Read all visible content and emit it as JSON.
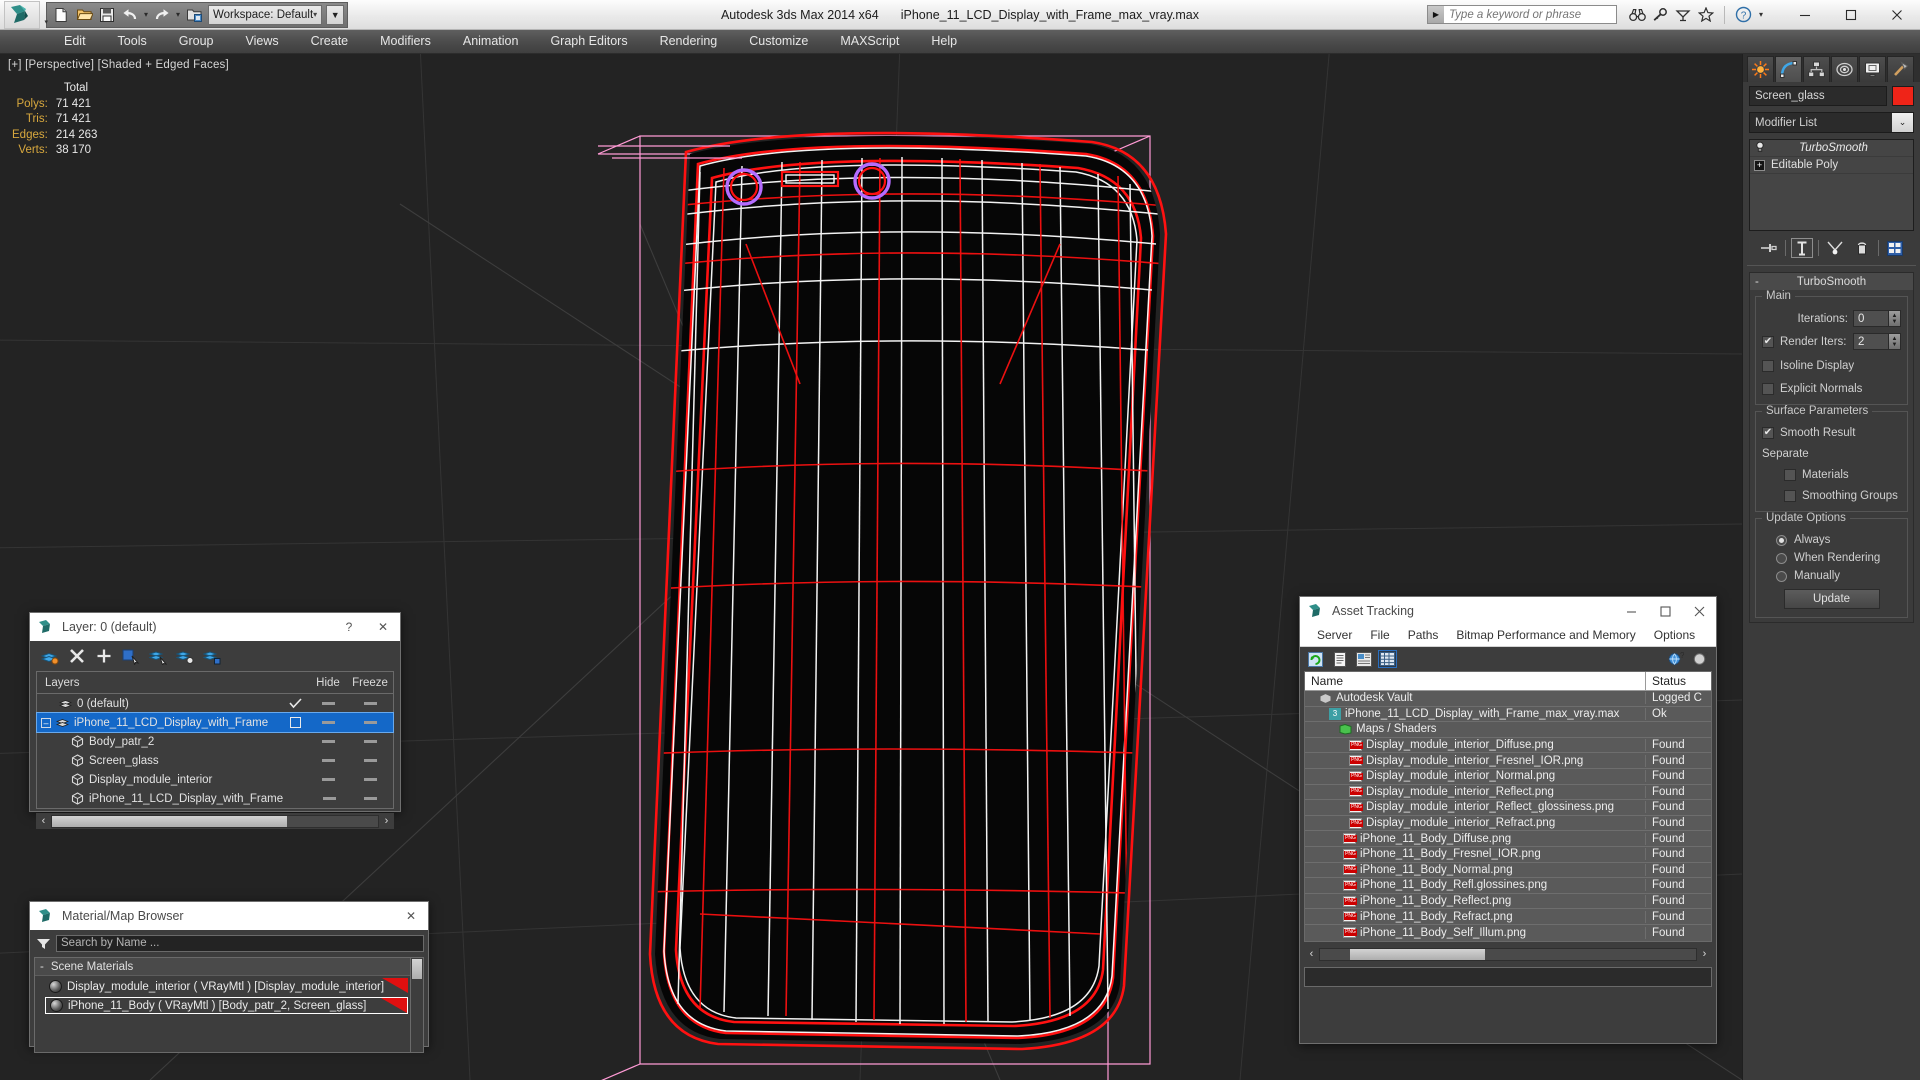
{
  "app": {
    "title": "Autodesk 3ds Max  2014 x64",
    "file_title": "iPhone_11_LCD_Display_with_Frame_max_vray.max",
    "workspace": "Workspace: Default",
    "search_placeholder": "Type a keyword or phrase"
  },
  "window_controls": {
    "minimize": "—",
    "maximize": "□",
    "close": "✕"
  },
  "menu": [
    "Edit",
    "Tools",
    "Group",
    "Views",
    "Create",
    "Modifiers",
    "Animation",
    "Graph Editors",
    "Rendering",
    "Customize",
    "MAXScript",
    "Help"
  ],
  "viewport": {
    "label": "[+] [Perspective] [Shaded + Edged Faces]",
    "stats": {
      "header": "Total",
      "rows": [
        {
          "key": "Polys:",
          "value": "71 421"
        },
        {
          "key": "Tris:",
          "value": "71 421"
        },
        {
          "key": "Edges:",
          "value": "214 263"
        },
        {
          "key": "Verts:",
          "value": "38 170"
        }
      ]
    }
  },
  "command_panel": {
    "tabs": [
      "create-tab",
      "modify-tab",
      "hierarchy-tab",
      "motion-tab",
      "display-tab",
      "utilities-tab"
    ],
    "active_tab_index": 1,
    "object_name": "Screen_glass",
    "object_color": "#ef2418",
    "modifier_list_label": "Modifier List",
    "stack": [
      {
        "label": "TurboSmooth",
        "selected": true
      },
      {
        "label": "Editable Poly",
        "selected": false
      }
    ],
    "turbosmooth": {
      "rollout_title": "TurboSmooth",
      "main_group": "Main",
      "iterations_label": "Iterations:",
      "iterations_value": "0",
      "render_iters_label": "Render Iters:",
      "render_iters_value": "2",
      "render_iters_checked": true,
      "isoline_display_label": "Isoline Display",
      "isoline_display_checked": false,
      "explicit_normals_label": "Explicit Normals",
      "explicit_normals_checked": false,
      "surface_group": "Surface Parameters",
      "smooth_result_label": "Smooth Result",
      "smooth_result_checked": true,
      "separate_label": "Separate",
      "materials_label": "Materials",
      "materials_checked": false,
      "smoothing_groups_label": "Smoothing Groups",
      "smoothing_groups_checked": false,
      "update_group": "Update Options",
      "always_label": "Always",
      "when_rendering_label": "When Rendering",
      "manually_label": "Manually",
      "selected_update": "Always",
      "update_button": "Update"
    }
  },
  "layer_window": {
    "title": "Layer: 0 (default)",
    "help_button": "?",
    "close_button": "✕",
    "columns": {
      "name": "Layers",
      "hide": "Hide",
      "freeze": "Freeze"
    },
    "rows": [
      {
        "label": "0 (default)",
        "indent": 1,
        "icon": "layer-icon",
        "selected": false,
        "current": true
      },
      {
        "label": "iPhone_11_LCD_Display_with_Frame",
        "indent": 0,
        "icon": "layer-icon",
        "selected": true,
        "current": false
      },
      {
        "label": "Body_patr_2",
        "indent": 2,
        "icon": "object-icon",
        "selected": false,
        "current": false
      },
      {
        "label": "Screen_glass",
        "indent": 2,
        "icon": "object-icon",
        "selected": false,
        "current": false
      },
      {
        "label": "Display_module_interior",
        "indent": 2,
        "icon": "object-icon",
        "selected": false,
        "current": false
      },
      {
        "label": "iPhone_11_LCD_Display_with_Frame",
        "indent": 2,
        "icon": "object-icon",
        "selected": false,
        "current": false
      }
    ]
  },
  "material_browser": {
    "title": "Material/Map Browser",
    "close_button": "✕",
    "search_placeholder": "Search by Name ...",
    "group_label": "Scene Materials",
    "group_toggle": "-",
    "items": [
      {
        "label": "Display_module_interior ( VRayMtl ) [Display_module_interior]",
        "selected": false
      },
      {
        "label": "iPhone_11_Body  ( VRayMtl )  [Body_patr_2, Screen_glass]",
        "selected": true
      }
    ]
  },
  "asset_tracking": {
    "title": "Asset Tracking",
    "menu": [
      "Server",
      "File",
      "Paths",
      "Bitmap Performance and Memory",
      "Options"
    ],
    "columns": {
      "name": "Name",
      "status": "Status"
    },
    "rows": [
      {
        "label": "Autodesk Vault",
        "status": "Logged C",
        "indent": 1,
        "icon": "vault-icon"
      },
      {
        "label": "iPhone_11_LCD_Display_with_Frame_max_vray.max",
        "status": "Ok",
        "indent": 2,
        "icon": "max-icon"
      },
      {
        "label": "Maps / Shaders",
        "status": "",
        "indent": 3,
        "icon": "maps-icon"
      },
      {
        "label": "Display_module_interior_Diffuse.png",
        "status": "Found",
        "indent": 4,
        "icon": "png-icon"
      },
      {
        "label": "Display_module_interior_Fresnel_IOR.png",
        "status": "Found",
        "indent": 4,
        "icon": "png-icon"
      },
      {
        "label": "Display_module_interior_Normal.png",
        "status": "Found",
        "indent": 4,
        "icon": "png-icon"
      },
      {
        "label": "Display_module_interior_Reflect.png",
        "status": "Found",
        "indent": 4,
        "icon": "png-icon"
      },
      {
        "label": "Display_module_interior_Reflect_glossiness.png",
        "status": "Found",
        "indent": 4,
        "icon": "png-icon"
      },
      {
        "label": "Display_module_interior_Refract.png",
        "status": "Found",
        "indent": 4,
        "icon": "png-icon"
      },
      {
        "label": "iPhone_11_Body_Diffuse.png",
        "status": "Found",
        "indent": 3,
        "icon": "png-icon"
      },
      {
        "label": "iPhone_11_Body_Fresnel_IOR.png",
        "status": "Found",
        "indent": 3,
        "icon": "png-icon"
      },
      {
        "label": "iPhone_11_Body_Normal.png",
        "status": "Found",
        "indent": 3,
        "icon": "png-icon"
      },
      {
        "label": "iPhone_11_Body_Refl.glossines.png",
        "status": "Found",
        "indent": 3,
        "icon": "png-icon"
      },
      {
        "label": "iPhone_11_Body_Reflect.png",
        "status": "Found",
        "indent": 3,
        "icon": "png-icon"
      },
      {
        "label": "iPhone_11_Body_Refract.png",
        "status": "Found",
        "indent": 3,
        "icon": "png-icon"
      },
      {
        "label": "iPhone_11_Body_Self_Illum.png",
        "status": "Found",
        "indent": 3,
        "icon": "png-icon"
      }
    ]
  },
  "colors": {
    "wire_selected": "#ff1111",
    "wire_edges": "#ffffff",
    "gizmo_pink": "#ff9ad5",
    "camera_ring": "#b46cff",
    "viewport_bg": "#232323",
    "accent_blue": "#1468c8"
  }
}
